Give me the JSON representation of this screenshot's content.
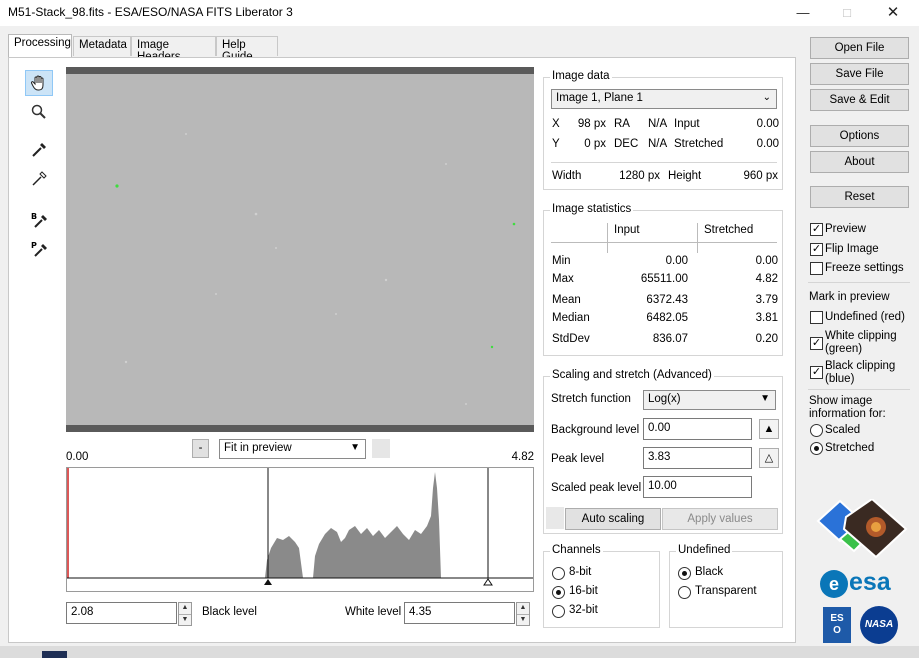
{
  "window": {
    "title": "M51-Stack_98.fits - ESA/ESO/NASA FITS Liberator 3"
  },
  "tabs": [
    {
      "label": "Processing"
    },
    {
      "label": "Metadata"
    },
    {
      "label": "Image Headers"
    },
    {
      "label": "Help Guide"
    }
  ],
  "preview": {
    "zoom_minus": "-",
    "zoom_select": "Fit in preview",
    "hist_min": "0.00",
    "hist_max": "4.82"
  },
  "levels": {
    "black_value": "2.08",
    "black_label": "Black level",
    "white_label": "White level",
    "white_value": "4.35"
  },
  "image_data": {
    "title": "Image data",
    "plane": "Image 1, Plane 1",
    "x_label": "X",
    "x_value": "98 px",
    "ra_label": "RA",
    "ra_value": "N/A",
    "input_label": "Input",
    "input_value": "0.00",
    "y_label": "Y",
    "y_value": "0 px",
    "dec_label": "DEC",
    "dec_value": "N/A",
    "stretched_label": "Stretched",
    "stretched_value": "0.00",
    "width_label": "Width",
    "width_value": "1280 px",
    "height_label": "Height",
    "height_value": "960 px"
  },
  "stats": {
    "title": "Image statistics",
    "col_input": "Input",
    "col_stretched": "Stretched",
    "rows": [
      {
        "label": "Min",
        "input": "0.00",
        "stretched": "0.00"
      },
      {
        "label": "Max",
        "input": "65511.00",
        "stretched": "4.82"
      },
      {
        "label": "Mean",
        "input": "6372.43",
        "stretched": "3.79"
      },
      {
        "label": "Median",
        "input": "6482.05",
        "stretched": "3.81"
      },
      {
        "label": "StdDev",
        "input": "836.07",
        "stretched": "0.20"
      }
    ]
  },
  "scaling": {
    "title": "Scaling and stretch (Advanced)",
    "stretch_label": "Stretch function",
    "stretch_value": "Log(x)",
    "bg_label": "Background level",
    "bg_value": "0.00",
    "peak_label": "Peak level",
    "peak_value": "3.83",
    "scaled_label": "Scaled peak level",
    "scaled_value": "10.00",
    "auto_btn": "Auto scaling",
    "apply_btn": "Apply values"
  },
  "channels": {
    "title": "Channels",
    "options": [
      "8-bit",
      "16-bit",
      "32-bit"
    ],
    "selected": 1
  },
  "undefined_group": {
    "title": "Undefined",
    "options": [
      "Black",
      "Transparent"
    ],
    "selected": 0
  },
  "right": {
    "open": "Open File",
    "save": "Save File",
    "save_edit": "Save & Edit",
    "options": "Options",
    "about": "About",
    "reset": "Reset",
    "preview": "Preview",
    "flip": "Flip Image",
    "freeze": "Freeze settings",
    "mark_title": "Mark in preview",
    "undef_red": "Undefined (red)",
    "white_clip": "White clipping (green)",
    "black_clip": "Black clipping (blue)",
    "show_info": "Show image information for:",
    "scaled": "Scaled",
    "stretched": "Stretched",
    "esa": "esa",
    "nasa": "NASA",
    "eso": "ES O"
  },
  "colors": {
    "accent_blue": "#cce4f7",
    "esa_blue": "#0a76b8",
    "clip_red": "#d02020"
  }
}
